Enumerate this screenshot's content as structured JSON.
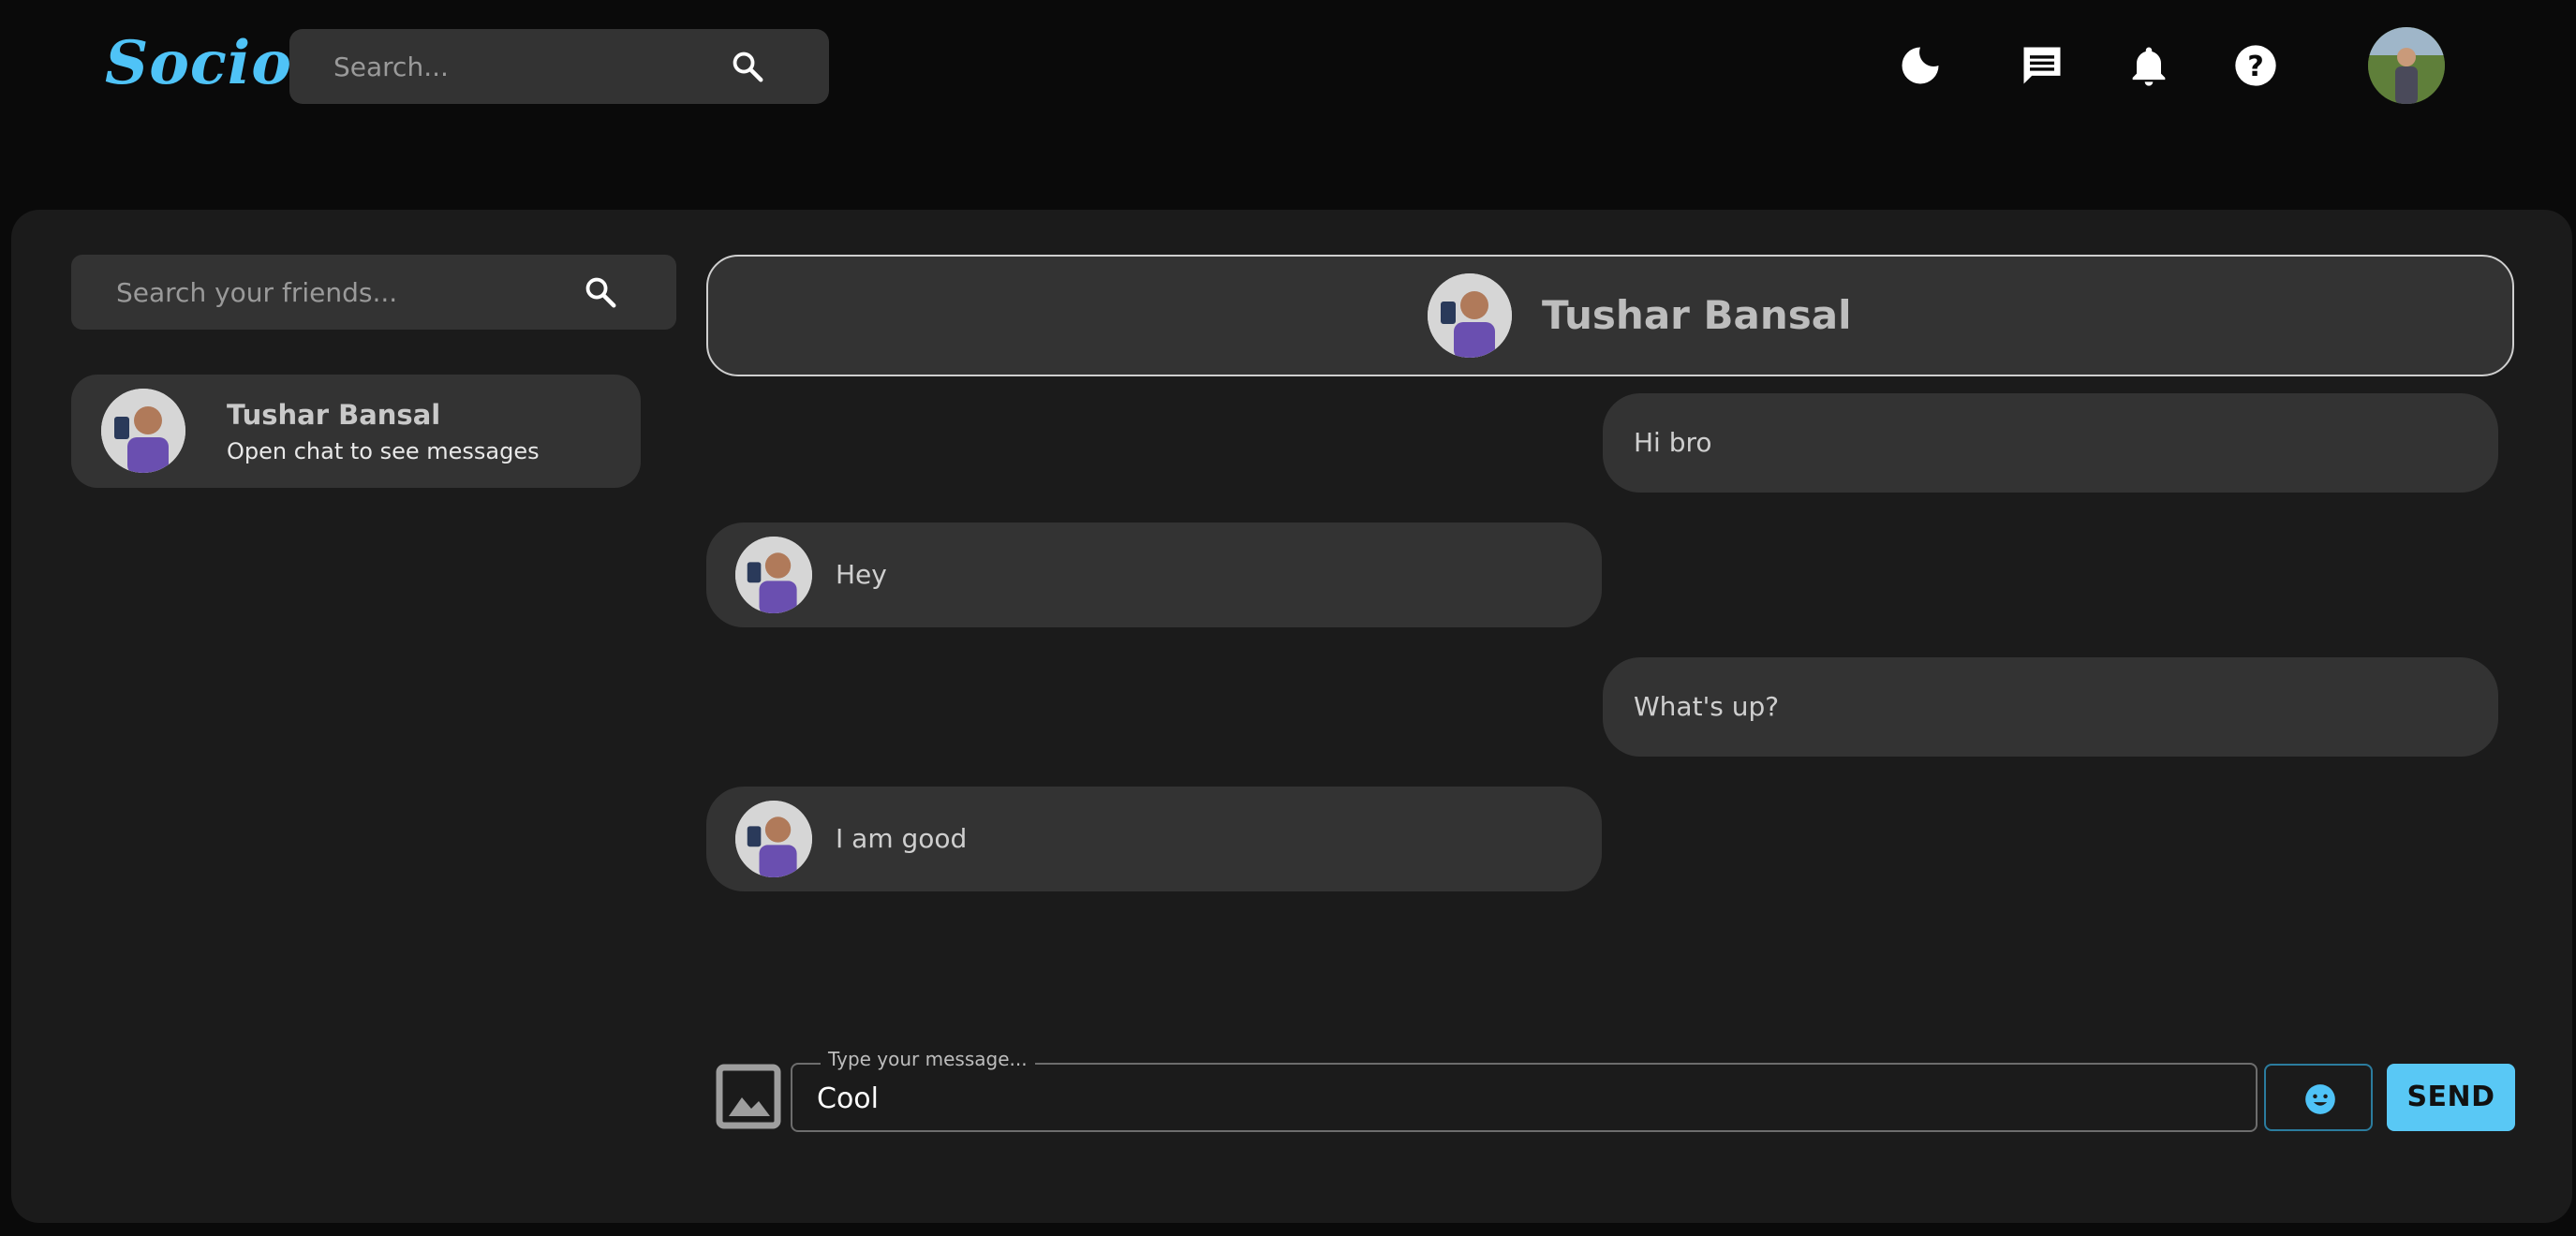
{
  "app": {
    "logo": "Socio"
  },
  "topbar": {
    "search_placeholder": "Search...",
    "icons": [
      "moon-icon",
      "chat-icon",
      "bell-icon",
      "help-icon"
    ]
  },
  "sidebar": {
    "search_placeholder": "Search your friends...",
    "friends": [
      {
        "name": "Tushar Bansal",
        "subtitle": "Open chat to see messages"
      }
    ]
  },
  "chat": {
    "contact_name": "Tushar Bansal",
    "messages": [
      {
        "side": "sent",
        "text": "Hi bro"
      },
      {
        "side": "received",
        "text": "Hey"
      },
      {
        "side": "sent",
        "text": "What's up?"
      },
      {
        "side": "received",
        "text": "I am good"
      }
    ],
    "composer": {
      "label": "Type your message...",
      "value": "Cool",
      "send_label": "SEND"
    }
  },
  "colors": {
    "accent": "#4fc3f7",
    "send_button": "#59c8f5",
    "panel": "#1b1b1b",
    "bubble": "#333333"
  }
}
